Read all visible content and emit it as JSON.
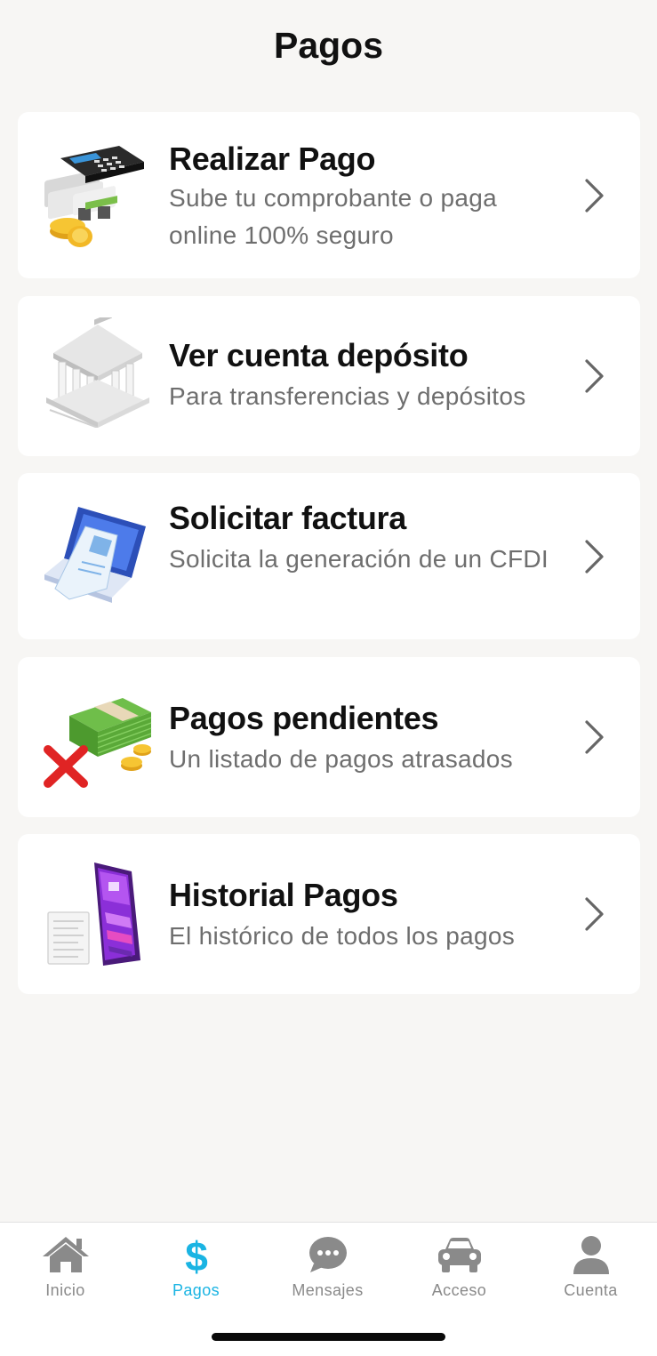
{
  "header": {
    "title": "Pagos"
  },
  "menu": {
    "items": [
      {
        "title": "Realizar Pago",
        "subtitle": "Sube tu comprobante o paga online 100% seguro",
        "icon": "card-terminal-payment-icon"
      },
      {
        "title": "Ver cuenta depósito",
        "subtitle": "Para transferencias y depósitos",
        "icon": "bank-icon"
      },
      {
        "title": "Solicitar factura",
        "subtitle": "Solicita la generación de un CFDI",
        "icon": "laptop-invoice-icon"
      },
      {
        "title": "Pagos pendientes",
        "subtitle": "Un listado de pagos atrasados",
        "icon": "money-pending-icon"
      },
      {
        "title": "Historial Pagos",
        "subtitle": "El histórico de todos los pagos",
        "icon": "phone-history-icon"
      }
    ]
  },
  "tabbar": {
    "active": "Pagos",
    "active_color": "#1ab4e3",
    "inactive_color": "#8a8a8a",
    "tabs": [
      {
        "label": "Inicio",
        "icon": "home-icon"
      },
      {
        "label": "Pagos",
        "icon": "dollar-icon"
      },
      {
        "label": "Mensajes",
        "icon": "chat-bubble-icon"
      },
      {
        "label": "Acceso",
        "icon": "car-icon"
      },
      {
        "label": "Cuenta",
        "icon": "user-icon"
      }
    ]
  }
}
